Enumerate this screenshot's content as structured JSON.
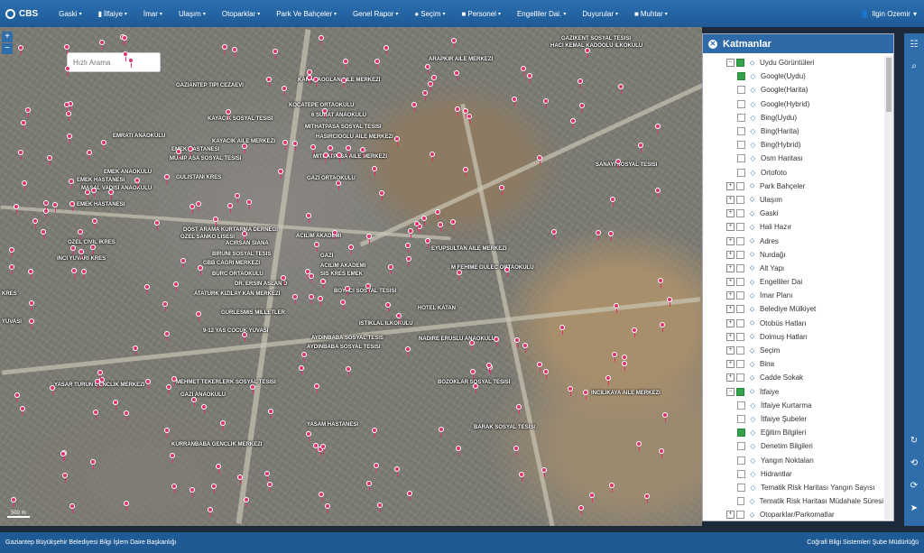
{
  "app": {
    "title": "CBS"
  },
  "nav": [
    {
      "label": "Gaski",
      "icon": ""
    },
    {
      "label": "İlfaiye",
      "icon": "▮"
    },
    {
      "label": "İmar",
      "icon": ""
    },
    {
      "label": "Ulaşım",
      "icon": ""
    },
    {
      "label": "Otoparklar",
      "icon": ""
    },
    {
      "label": "Park Ve Bahçeler",
      "icon": ""
    },
    {
      "label": "Genel Rapor",
      "icon": ""
    },
    {
      "label": "Seçim",
      "icon": "●"
    },
    {
      "label": "Personel",
      "icon": "■"
    },
    {
      "label": "Engelliler Dai.",
      "icon": ""
    },
    {
      "label": "Duyurular",
      "icon": ""
    },
    {
      "label": "Muhtar",
      "icon": "■"
    }
  ],
  "user": {
    "name": "Ilgin Ozemir"
  },
  "map": {
    "search_placeholder": "Hızlı Arama",
    "zoom_in": "+",
    "zoom_out": "−",
    "scale": "500 m",
    "labels": [
      "GAZIKENT SOSYAL TESISI",
      "HACI KEMAL KADOOLU ILKOKULU",
      "ARAPKIR AILE MERKEZI",
      "KARACAOGLAN AILE MERKEZI",
      "GAZIANTEP TIPI CEZAEVI",
      "KOCATEPE ORTAOKULU",
      "6 SUBAT ANAOKULU",
      "KAYACIK SOSYAL TESISI",
      "MITHATPASA SOSYAL TESISI",
      "HASIRCIOGLU AILE MERKEZI",
      "EMRATI ANAOKULU",
      "KAYACIK AILE MERKEZI",
      "EMEK HASTANESI",
      "MUNIP ASA SOSYAL TESISI",
      "MITHATPASA AILE MERKEZI",
      "SANAYI SOSYAL TESISI",
      "EMEK ANAOKULU",
      "EMEK HASTANESI",
      "GULISTANI KRES",
      "GAZI ORTAOKULU",
      "MASAL VADISI ANAOKULU",
      "EMEK HASTANESI",
      "DOST ARAMA KURTARMA DERNEGI",
      "OZEL SANKO LISESI",
      "ACILIM AKADEMI",
      "OZEL CIVIL IKRES",
      "ACIRSAN SIANA",
      "EYUPSULTAN AILE MERKEZI",
      "INCI YUVARI KRES",
      "BIRUNI SOSYAL TESIS",
      "GAZI",
      "GBB CAGRI MERKEZI",
      "ACILIM AKADEMI",
      "BURC ORTAOKULU",
      "SIS KRES EMEK",
      "M FEHIME GULEC ORTAOKULU",
      "DR. ERSIN ASLAN D",
      "BOYACI SOSYAL TESISI",
      "KRES",
      "ATATURK KIZILAY KAN MERKEZI",
      "HOTEL KATAN",
      "GURLESMIS MILLETLER",
      "YUVASI",
      "ISTIKLAL ILKOKULU",
      "9-12 YAS COCUK YUVASI",
      "AYDINBABA SOSYAL TESIS",
      "NADIRE ERUSLU ANAOKULU",
      "AYDINBABA SOSYAL TESISI",
      "MEHMET TEKERLERK SOSYAL TESISI",
      "YASAR TURUN GENCLIK MERKEZI",
      "BOZOKLAR SOSYAL TESISI",
      "GAZI ANAOKULU",
      "INCILIKAYA AILE MERKEZI",
      "YASAM HASTANESI",
      "BARAK SOSYAL TESISI",
      "KURRANBABA GENCLIK MERKEZI"
    ]
  },
  "layers": {
    "title": "Katmanlar",
    "items": [
      {
        "label": "Uydu Görüntüleri",
        "level": 1,
        "toggle": "−",
        "checked": true
      },
      {
        "label": "Google(Uydu)",
        "level": 2,
        "checked": true
      },
      {
        "label": "Google(Harita)",
        "level": 2,
        "checked": false
      },
      {
        "label": "Google(Hybrid)",
        "level": 2,
        "checked": false
      },
      {
        "label": "Bing(Uydu)",
        "level": 2,
        "checked": false
      },
      {
        "label": "Bing(Harita)",
        "level": 2,
        "checked": false
      },
      {
        "label": "Bing(Hybrid)",
        "level": 2,
        "checked": false
      },
      {
        "label": "Osm Haritası",
        "level": 2,
        "checked": false
      },
      {
        "label": "Ortofoto",
        "level": 2,
        "checked": false
      },
      {
        "label": "Park Bahçeler",
        "level": 1,
        "toggle": "+",
        "checked": false
      },
      {
        "label": "Ulaşım",
        "level": 1,
        "toggle": "+",
        "checked": false
      },
      {
        "label": "Gaski",
        "level": 1,
        "toggle": "+",
        "checked": false
      },
      {
        "label": "Hali Hazır",
        "level": 1,
        "toggle": "+",
        "checked": false
      },
      {
        "label": "Adres",
        "level": 1,
        "toggle": "+",
        "checked": false
      },
      {
        "label": "Nurdağı",
        "level": 1,
        "toggle": "+",
        "checked": false
      },
      {
        "label": "Alt Yapı",
        "level": 1,
        "toggle": "+",
        "checked": false
      },
      {
        "label": "Engelliler Dai",
        "level": 1,
        "toggle": "+",
        "checked": false
      },
      {
        "label": "İmar Planı",
        "level": 1,
        "toggle": "+",
        "checked": false
      },
      {
        "label": "Belediye Mülkiyet",
        "level": 1,
        "toggle": "+",
        "checked": false
      },
      {
        "label": "Otobüs Hatları",
        "level": 1,
        "toggle": "+",
        "checked": false
      },
      {
        "label": "Dolmuş Hatları",
        "level": 1,
        "toggle": "+",
        "checked": false
      },
      {
        "label": "Seçim",
        "level": 1,
        "toggle": "+",
        "checked": false
      },
      {
        "label": "Bina",
        "level": 1,
        "toggle": "+",
        "checked": false
      },
      {
        "label": "Cadde Sokak",
        "level": 1,
        "toggle": "+",
        "checked": false
      },
      {
        "label": "İtfaiye",
        "level": 1,
        "toggle": "−",
        "checked": true
      },
      {
        "label": "İtfaiye Kurtarma",
        "level": 2,
        "checked": false
      },
      {
        "label": "İtfaiye Şubeler",
        "level": 2,
        "checked": false
      },
      {
        "label": "Eğitim Bilgileri",
        "level": 2,
        "checked": true
      },
      {
        "label": "Denetim Bilgileri",
        "level": 2,
        "checked": false
      },
      {
        "label": "Yangın Noktaları",
        "level": 2,
        "checked": false
      },
      {
        "label": "Hidrantlar",
        "level": 2,
        "checked": false
      },
      {
        "label": "Tematik Risk Haritası Yangın Sayısı",
        "level": 2,
        "checked": false
      },
      {
        "label": "Tematik Risk Haritası Müdahale Süresi",
        "level": 2,
        "checked": false
      },
      {
        "label": "Otoparklar/Parkomatlar",
        "level": 1,
        "toggle": "+",
        "checked": false
      }
    ]
  },
  "footer": {
    "left": "Gaziantep Büyükşehir Belediyesi Bilgi İşlem Daire Başkanlığı",
    "right": "Coğrafi Bilgi Sistemleri Şube Müdürlüğü"
  },
  "colors": {
    "nav": "#2b6fb0",
    "pin": "#e0306e",
    "checked": "#35a24a"
  }
}
